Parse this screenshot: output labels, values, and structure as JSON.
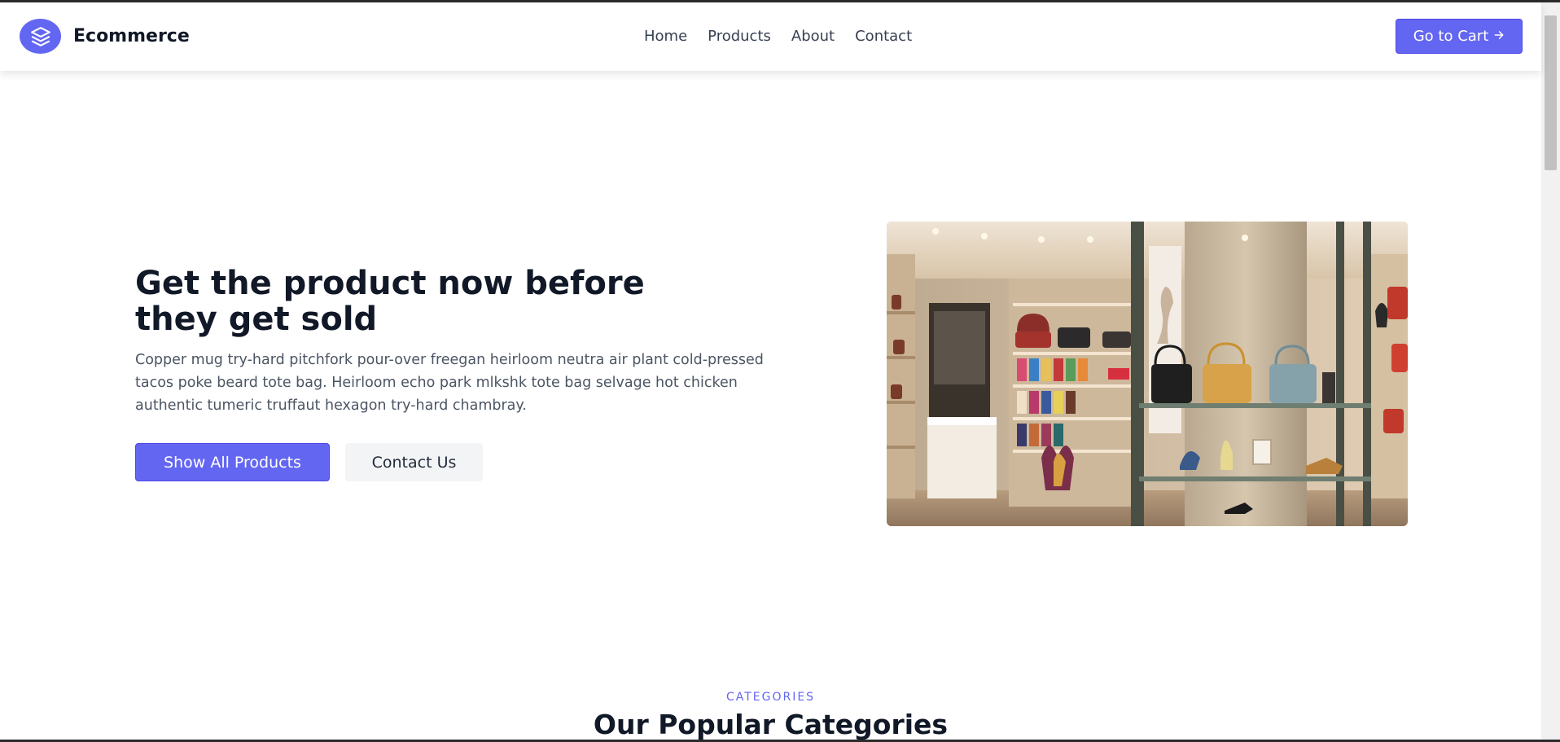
{
  "brand": {
    "name": "Ecommerce",
    "accent_color": "#6366f1",
    "logo_icon": "layers-icon"
  },
  "nav": {
    "items": [
      "Home",
      "Products",
      "About",
      "Contact"
    ]
  },
  "header": {
    "cart_label": "Go to Cart",
    "cart_icon": "arrow-right-icon"
  },
  "hero": {
    "title_line1": "Get the product now before",
    "title_line2": "they get sold",
    "description": "Copper mug try-hard pitchfork pour-over freegan heirloom neutra air plant cold-pressed tacos poke beard tote bag. Heirloom echo park mlkshk tote bag selvage hot chicken authentic tumeric truffaut hexagon try-hard chambray.",
    "primary_button": "Show All Products",
    "secondary_button": "Contact Us"
  },
  "categories": {
    "label": "CATEGORIES",
    "title": "Our Popular Categories"
  }
}
